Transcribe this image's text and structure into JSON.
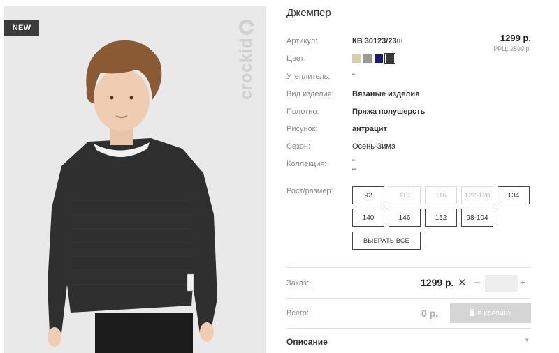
{
  "product": {
    "badge": "NEW",
    "brand": "crockid",
    "title": "Джемпер",
    "price": "1299 р.",
    "rrp": "РРЦ: 2599 р."
  },
  "attributes": [
    {
      "label": "Артикул:",
      "value": "КВ 30123/23ш"
    },
    {
      "label": "Цвет:",
      "value": ""
    },
    {
      "label": "Утеплитель:",
      "value": "\""
    },
    {
      "label": "Вид изделия:",
      "value": "Вязаные изделия"
    },
    {
      "label": "Полотно:",
      "value": "Пряжа полушерсть"
    },
    {
      "label": "Рисунок:",
      "value": "антрацит"
    },
    {
      "label": "Сезон:",
      "value": "Осень-Зима"
    },
    {
      "label": "Коллекция:",
      "value": "\""
    },
    {
      "label": "Рост/размер:",
      "value": ""
    }
  ],
  "collection_extra": "–",
  "colors": [
    "#d8ccab",
    "#9a9a9a",
    "#1c1c6b",
    "#3a3a3a"
  ],
  "sizes": [
    {
      "label": "92",
      "available": true
    },
    {
      "label": "110",
      "available": false
    },
    {
      "label": "116",
      "available": false
    },
    {
      "label": "122-128",
      "available": false
    },
    {
      "label": "134",
      "available": true
    },
    {
      "label": "140",
      "available": true
    },
    {
      "label": "146",
      "available": true
    },
    {
      "label": "152",
      "available": true
    },
    {
      "label": "98-104",
      "available": true
    }
  ],
  "select_all_label": "ВЫБРАТЬ ВСЕ",
  "order": {
    "label": "Заказ:",
    "price": "1299 р.",
    "multiply": "✕",
    "minus": "–",
    "plus": "+",
    "quantity": ""
  },
  "total": {
    "label": "Всего:",
    "value": "0 р.",
    "cart_label": "В КОРЗИНУ"
  },
  "description": {
    "label": "Описание",
    "chevron": "▼"
  }
}
